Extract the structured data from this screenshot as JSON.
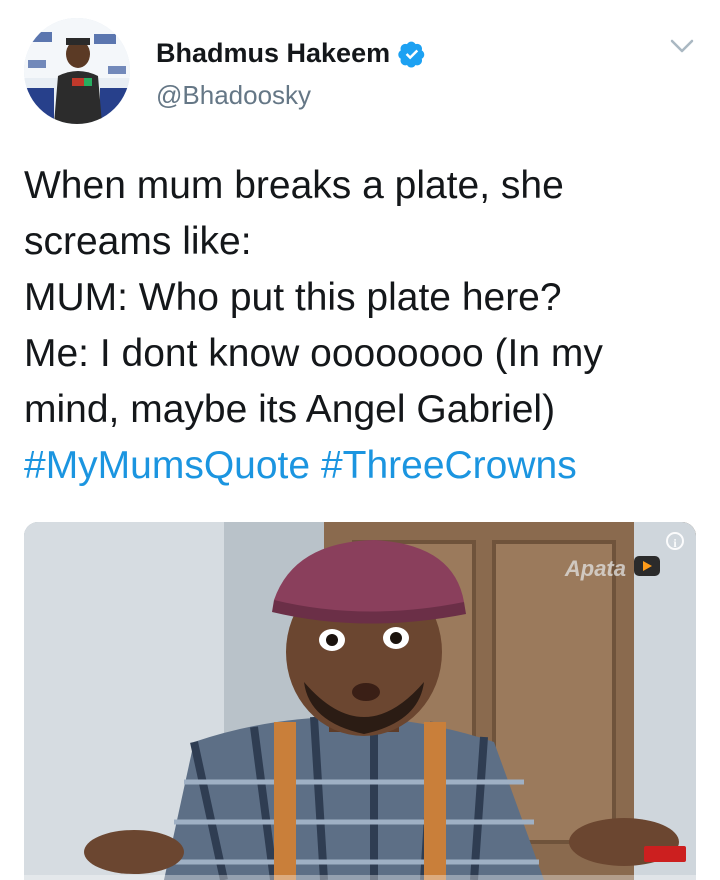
{
  "tweet": {
    "display_name": "Bhadmus Hakeem",
    "handle": "@Bhadoosky",
    "verified": true,
    "lines": [
      "When mum breaks a plate, she",
      "screams like:",
      "MUM: Who put this plate here?",
      "Me: I dont know oooooooo (In my",
      "mind, maybe its Angel Gabriel)"
    ],
    "hashtags": [
      "#MyMumsQuote",
      "#ThreeCrowns"
    ]
  },
  "media": {
    "watermark": "Apata",
    "progress_fraction": 0.0
  },
  "icons": {
    "verified": "verified-badge-icon",
    "menu": "chevron-down-icon",
    "info": "info-icon",
    "play": "play-icon"
  },
  "colors": {
    "hashtag": "#1b95e0",
    "verified": "#1da1f2",
    "handle": "#657786",
    "progress": "#e02424"
  }
}
